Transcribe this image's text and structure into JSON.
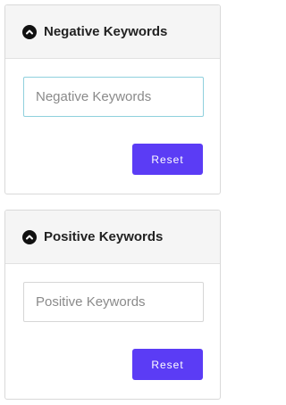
{
  "panels": [
    {
      "title": "Negative Keywords",
      "input_placeholder": "Negative Keywords",
      "input_value": "",
      "reset_label": "Reset",
      "icon": "chevron-up-circle-icon"
    },
    {
      "title": "Positive Keywords",
      "input_placeholder": "Positive Keywords",
      "input_value": "",
      "reset_label": "Reset",
      "icon": "chevron-up-circle-icon"
    }
  ],
  "colors": {
    "accent": "#5b3cf5",
    "header_bg": "#f5f5f5",
    "focus_border": "#8fd0dd"
  }
}
